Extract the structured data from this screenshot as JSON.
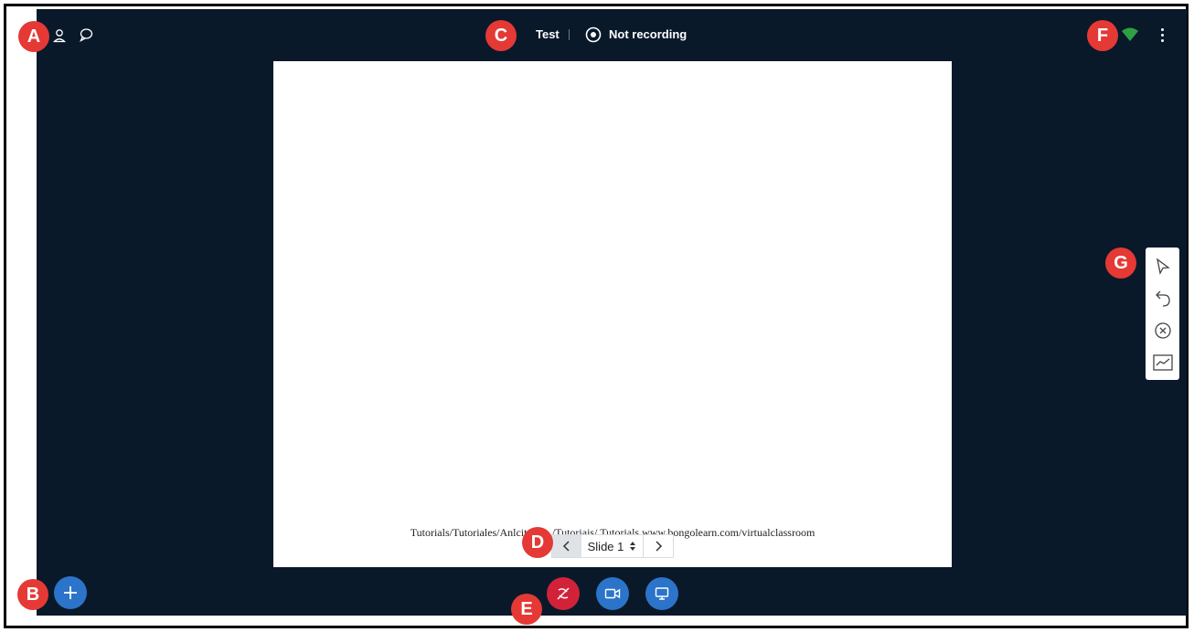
{
  "header": {
    "title": "Test",
    "recording_status": "Not recording"
  },
  "slide": {
    "caption": "Tutorials/Tutoriales/Anlcitur... ../Tutoriais/ Tutorials www.bongolearn.com/virtualclassroom"
  },
  "slide_nav": {
    "current_slide": "Slide 1"
  },
  "callouts": {
    "a": "A",
    "b": "B",
    "c": "C",
    "d": "D",
    "e": "E",
    "f": "F",
    "g": "G"
  },
  "icons": {
    "users": "user-icon",
    "chat": "chat-icon",
    "record": "record-icon",
    "connection": "connection-status-icon",
    "options": "kebab-menu-icon",
    "actions": "plus-icon",
    "audio": "mic-off-icon",
    "video": "video-icon",
    "screenshare": "screen-share-icon",
    "pointer": "pointer-icon",
    "undo": "undo-icon",
    "clear": "clear-icon",
    "annotation": "annotation-chart-icon"
  },
  "colors": {
    "background": "#09192a",
    "callout": "#e53935",
    "primary_button": "#2b74c9",
    "leave_audio_button": "#d2223a",
    "connection_good": "#2ea043"
  }
}
